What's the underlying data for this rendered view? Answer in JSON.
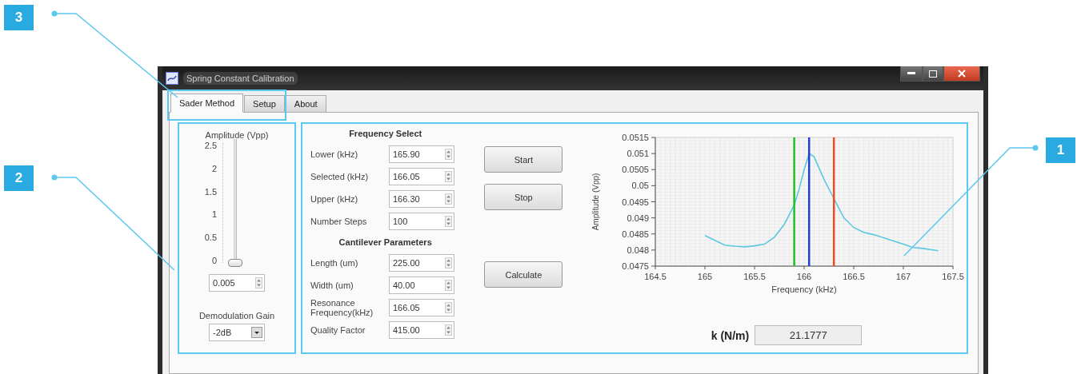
{
  "window": {
    "title": "Spring Constant Calibration"
  },
  "tabs": [
    {
      "label": "Sader Method",
      "selected": true
    },
    {
      "label": "Setup",
      "selected": false
    },
    {
      "label": "About",
      "selected": false
    }
  ],
  "amplitude": {
    "label": "Amplitude (Vpp)",
    "ticks": [
      "2.5",
      "2",
      "1.5",
      "1",
      "0.5",
      "0"
    ],
    "level": 0.002,
    "value": "0.005"
  },
  "demodulation": {
    "label": "Demodulation Gain",
    "value": "-2dB"
  },
  "frequency_select": {
    "heading": "Frequency Select",
    "fields": [
      {
        "label": "Lower (kHz)",
        "value": "165.90"
      },
      {
        "label": "Selected (kHz)",
        "value": "166.05"
      },
      {
        "label": "Upper (kHz)",
        "value": "166.30"
      },
      {
        "label": "Number Steps",
        "value": "100"
      }
    ]
  },
  "cantilever": {
    "heading": "Cantilever Parameters",
    "fields": [
      {
        "label": "Length (um)",
        "value": "225.00"
      },
      {
        "label": "Width (um)",
        "value": "40.00"
      },
      {
        "label": "Resonance Frequency(kHz)",
        "value": "166.05"
      },
      {
        "label": "Quality Factor",
        "value": "415.00"
      }
    ]
  },
  "buttons": [
    "Start",
    "Stop",
    "Calculate"
  ],
  "chart": {
    "chart_data": {
      "type": "line",
      "xlabel": "Frequency (kHz)",
      "ylabel": "Amplitude (Vpp)",
      "x": [
        165,
        165.1,
        165.2,
        165.3,
        165.4,
        165.5,
        165.6,
        165.7,
        165.8,
        165.9,
        165.95,
        166,
        166.05,
        166.1,
        166.2,
        166.3,
        166.4,
        166.5,
        166.6,
        166.7,
        166.8,
        166.9,
        167,
        167.1,
        167.2,
        167.35
      ],
      "grid": true,
      "series": [
        {
          "color": "#5cc8e0",
          "values": [
            0.04845,
            0.0483,
            0.04815,
            0.04812,
            0.0481,
            0.04813,
            0.04818,
            0.0484,
            0.0488,
            0.0494,
            0.0499,
            0.0505,
            0.051,
            0.0509,
            0.0502,
            0.0496,
            0.049,
            0.0487,
            0.04855,
            0.04848,
            0.04838,
            0.04828,
            0.04818,
            0.04808,
            0.04805,
            0.04798
          ]
        }
      ],
      "xlim": [
        164.5,
        167.5
      ],
      "ylim": [
        0.0475,
        0.0515
      ],
      "xticks": [
        164.5,
        165,
        165.5,
        166,
        166.5,
        167,
        167.5
      ],
      "yticks": [
        0.0475,
        0.048,
        0.0485,
        0.049,
        0.0495,
        0.05,
        0.0505,
        0.051,
        0.0515
      ],
      "ref_lines": [
        {
          "axis": "x",
          "value": 165.9,
          "color": "#22c022"
        },
        {
          "axis": "x",
          "value": 166.05,
          "color": "#1e3fd0"
        },
        {
          "axis": "x",
          "value": 166.3,
          "color": "#f04a20"
        }
      ]
    }
  },
  "result": {
    "label": "k (N/m)",
    "value": "21.1777"
  },
  "callouts": [
    {
      "number": "3"
    },
    {
      "number": "2"
    },
    {
      "number": "1"
    }
  ]
}
